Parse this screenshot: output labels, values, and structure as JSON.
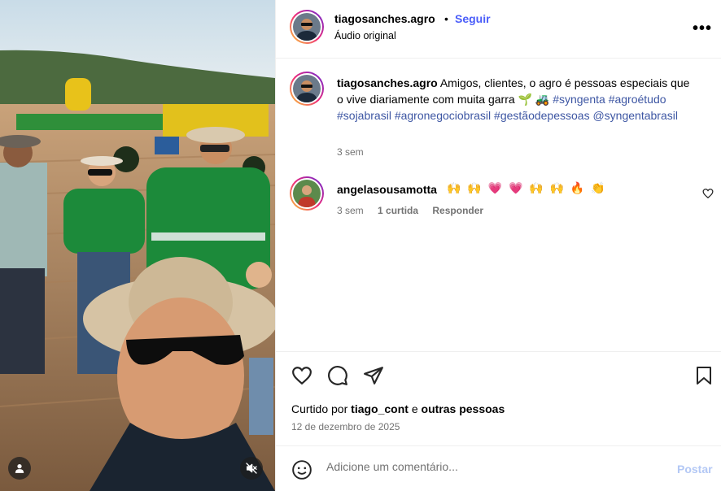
{
  "post": {
    "username": "tiagosanches.agro",
    "separator": "•",
    "follow_label": "Seguir",
    "audio_label": "Áudio original",
    "more_label": "•••",
    "caption_username": "tiagosanches.agro",
    "caption_text": "Amigos, clientes, o agro é pessoas especiais que o vive diariamente com muita garra 🌱 🚜",
    "hashtags": [
      "#syngenta",
      "#agroétudo",
      "#sojabrasil",
      "#agronegociobrasil",
      "#gestãodepessoas"
    ],
    "mention": "@syngentabrasil",
    "caption_time": "3 sem"
  },
  "comment": {
    "username": "angelasousamotta",
    "text": "🙌 🙌 💗 💗 🙌 🙌 🔥 👏",
    "time": "3 sem",
    "likes": "1 curtida",
    "reply_label": "Responder"
  },
  "footer": {
    "liked_by_prefix": "Curtido por",
    "liked_by_user": "tiago_cont",
    "liked_by_and": "e",
    "liked_by_others": "outras pessoas",
    "date": "12 de dezembro de 2025"
  },
  "add_comment": {
    "placeholder": "Adicione um comentário...",
    "post_label": "Postar"
  },
  "colors": {
    "link_blue": "#4a5df9",
    "hashtag_blue": "#3d56a3",
    "muted_gray": "#737373"
  }
}
